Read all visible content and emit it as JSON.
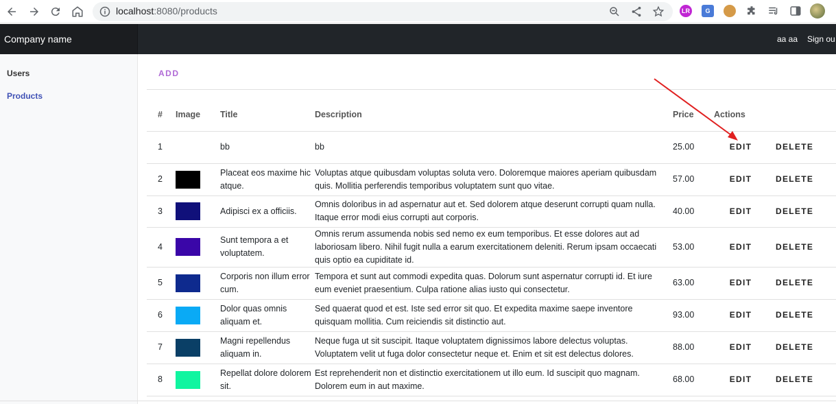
{
  "browser": {
    "url_host": "localhost",
    "url_rest": ":8080/products"
  },
  "navbar": {
    "brand": "Company name",
    "user": "aa aa",
    "signout": "Sign ou"
  },
  "sidebar": {
    "items": [
      {
        "label": "Users",
        "active": false
      },
      {
        "label": "Products",
        "active": true
      }
    ]
  },
  "main": {
    "add_label": "ADD",
    "table": {
      "headers": [
        "#",
        "Image",
        "Title",
        "Description",
        "Price",
        "Actions"
      ],
      "edit_label": "EDIT",
      "delete_label": "DELETE",
      "rows": [
        {
          "id": "1",
          "image_color": "",
          "title": "bb",
          "description": "bb",
          "price": "25.00"
        },
        {
          "id": "2",
          "image_color": "#000000",
          "title": "Placeat eos maxime hic atque.",
          "description": "Voluptas atque quibusdam voluptas soluta vero. Doloremque maiores aperiam quibusdam quis. Mollitia perferendis temporibus voluptatem sunt quo vitae.",
          "price": "57.00"
        },
        {
          "id": "3",
          "image_color": "#10107a",
          "title": "Adipisci ex a officiis.",
          "description": "Omnis doloribus in ad aspernatur aut et. Sed dolorem atque deserunt corrupti quam nulla. Itaque error modi eius corrupti aut corporis.",
          "price": "40.00"
        },
        {
          "id": "4",
          "image_color": "#3a06a8",
          "title": "Sunt tempora a et voluptatem.",
          "description": "Omnis rerum assumenda nobis sed nemo ex eum temporibus. Et esse dolores aut ad laboriosam libero. Nihil fugit nulla a earum exercitationem deleniti. Rerum ipsam occaecati quis optio ea cupiditate id.",
          "price": "53.00"
        },
        {
          "id": "5",
          "image_color": "#0e2a8e",
          "title": "Corporis non illum error cum.",
          "description": "Tempora et sunt aut commodi expedita quas. Dolorum sunt aspernatur corrupti id. Et iure eum eveniet praesentium. Culpa ratione alias iusto qui consectetur.",
          "price": "63.00"
        },
        {
          "id": "6",
          "image_color": "#0aaaf5",
          "title": "Dolor quas omnis aliquam et.",
          "description": "Sed quaerat quod et est. Iste sed error sit quo. Et expedita maxime saepe inventore quisquam mollitia. Cum reiciendis sit distinctio aut.",
          "price": "93.00"
        },
        {
          "id": "7",
          "image_color": "#0a3f66",
          "title": "Magni repellendus aliquam in.",
          "description": "Neque fuga ut sit suscipit. Itaque voluptatem dignissimos labore delectus voluptas. Voluptatem velit ut fuga dolor consectetur neque et. Enim et sit est delectus dolores.",
          "price": "88.00"
        },
        {
          "id": "8",
          "image_color": "#10f5a0",
          "title": "Repellat dolore dolorem sit.",
          "description": "Est reprehenderit non et distinctio exercitationem ut illo eum. Id suscipit quo magnam. Dolorem eum in aut maxime.",
          "price": "68.00"
        }
      ]
    }
  },
  "colors": {
    "navbar_bg": "#212529",
    "brand_bg": "#1b1d20",
    "sidebar_active": "#3f51b5",
    "add_button": "#b06ad6",
    "annotation_arrow": "#e02020"
  },
  "icons": [
    "back-icon",
    "forward-icon",
    "reload-icon",
    "home-icon",
    "info-icon",
    "zoom-icon",
    "share-icon",
    "star-icon",
    "extension-icon",
    "media-icon",
    "sidepanel-icon",
    "profile-avatar"
  ]
}
